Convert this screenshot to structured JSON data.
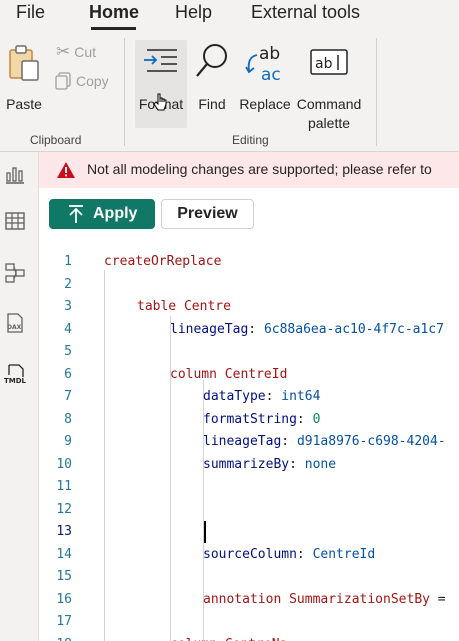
{
  "menu": {
    "items": [
      "File",
      "Home",
      "Help",
      "External tools"
    ],
    "active": "Home"
  },
  "ribbon": {
    "clipboard": {
      "paste_label": "Paste",
      "cut_label": "Cut",
      "copy_label": "Copy",
      "group_label": "Clipboard"
    },
    "editing": {
      "format_label": "Format",
      "find_label": "Find",
      "replace_label": "Replace",
      "command_palette_line1": "Command",
      "command_palette_line2": "palette",
      "group_label": "Editing"
    }
  },
  "rail": {
    "icons": [
      "report-view-icon",
      "table-view-icon",
      "model-view-icon",
      "dax-query-view-icon",
      "tmdl-view-icon"
    ]
  },
  "warning": {
    "text": "Not all modeling changes are supported; please refer to"
  },
  "toolbar": {
    "apply_label": "Apply",
    "preview_label": "Preview"
  },
  "editor": {
    "current_line": 13,
    "lines": [
      {
        "n": "1",
        "tokens": [
          {
            "t": "createOrReplace",
            "c": "kw"
          }
        ]
      },
      {
        "n": "2",
        "tokens": []
      },
      {
        "n": "3",
        "tokens": [
          {
            "t": "table ",
            "c": "kw"
          },
          {
            "t": "Centre",
            "c": "id"
          }
        ]
      },
      {
        "n": "4",
        "tokens": [
          {
            "t": "lineageTag",
            "c": "prop"
          },
          {
            "t": ": ",
            "c": "punct"
          },
          {
            "t": "6c88a6ea-ac10-4f7c-a1c7",
            "c": "str"
          }
        ]
      },
      {
        "n": "5",
        "tokens": []
      },
      {
        "n": "6",
        "tokens": [
          {
            "t": "column ",
            "c": "kw"
          },
          {
            "t": "CentreId",
            "c": "id"
          }
        ]
      },
      {
        "n": "7",
        "tokens": [
          {
            "t": "dataType",
            "c": "prop"
          },
          {
            "t": ": ",
            "c": "punct"
          },
          {
            "t": "int64",
            "c": "str"
          }
        ]
      },
      {
        "n": "8",
        "tokens": [
          {
            "t": "formatString",
            "c": "prop"
          },
          {
            "t": ": ",
            "c": "punct"
          },
          {
            "t": "0",
            "c": "val"
          }
        ]
      },
      {
        "n": "9",
        "tokens": [
          {
            "t": "lineageTag",
            "c": "prop"
          },
          {
            "t": ": ",
            "c": "punct"
          },
          {
            "t": "d91a8976-c698-4204-",
            "c": "str"
          }
        ]
      },
      {
        "n": "10",
        "tokens": [
          {
            "t": "summarizeBy",
            "c": "prop"
          },
          {
            "t": ": ",
            "c": "punct"
          },
          {
            "t": "none",
            "c": "str"
          }
        ]
      },
      {
        "n": "11",
        "tokens": []
      },
      {
        "n": "12",
        "tokens": []
      },
      {
        "n": "13",
        "tokens": []
      },
      {
        "n": "14",
        "tokens": [
          {
            "t": "sourceColumn",
            "c": "prop"
          },
          {
            "t": ": ",
            "c": "punct"
          },
          {
            "t": "CentreId",
            "c": "str"
          }
        ]
      },
      {
        "n": "15",
        "tokens": []
      },
      {
        "n": "16",
        "tokens": [
          {
            "t": "annotation ",
            "c": "kw"
          },
          {
            "t": "SummarizationSetBy",
            "c": "id"
          },
          {
            "t": " =",
            "c": "punct"
          }
        ]
      },
      {
        "n": "17",
        "tokens": []
      },
      {
        "n": "18",
        "tokens": [
          {
            "t": "column ",
            "c": "kw"
          },
          {
            "t": "CentreNa",
            "c": "id"
          }
        ]
      }
    ]
  },
  "colors": {
    "apply_green": "#117865",
    "warning_bg": "#fde7e9",
    "warning_icon": "#c50f1f",
    "accent_blue": "#0f6cbd"
  }
}
